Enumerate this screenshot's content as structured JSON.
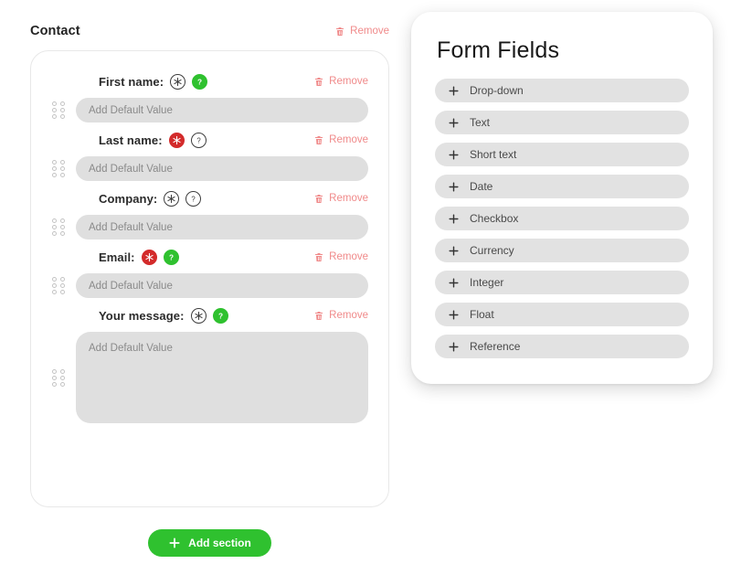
{
  "section": {
    "title": "Contact",
    "remove_label": "Remove",
    "remove_icon": "trash-icon"
  },
  "fields": [
    {
      "label": "First name:",
      "required_badge": {
        "icon": "asterisk-icon",
        "state": "off"
      },
      "help_badge": {
        "icon": "question-icon",
        "state": "on"
      },
      "remove_label": "Remove",
      "placeholder": "Add Default Value",
      "type": "input",
      "drag_handle": "drag-handle-icon"
    },
    {
      "label": "Last name:",
      "required_badge": {
        "icon": "asterisk-icon",
        "state": "on"
      },
      "help_badge": {
        "icon": "question-icon",
        "state": "off"
      },
      "remove_label": "Remove",
      "placeholder": "Add Default Value",
      "type": "input",
      "drag_handle": "drag-handle-icon"
    },
    {
      "label": "Company:",
      "required_badge": {
        "icon": "asterisk-icon",
        "state": "off"
      },
      "help_badge": {
        "icon": "question-icon",
        "state": "off"
      },
      "remove_label": "Remove",
      "placeholder": "Add Default Value",
      "type": "input",
      "drag_handle": "drag-handle-icon"
    },
    {
      "label": "Email:",
      "required_badge": {
        "icon": "asterisk-icon",
        "state": "on"
      },
      "help_badge": {
        "icon": "question-icon",
        "state": "on"
      },
      "remove_label": "Remove",
      "placeholder": "Add Default Value",
      "type": "input",
      "drag_handle": "drag-handle-icon"
    },
    {
      "label": "Your message:",
      "required_badge": {
        "icon": "asterisk-icon",
        "state": "off"
      },
      "help_badge": {
        "icon": "question-icon",
        "state": "on"
      },
      "remove_label": "Remove",
      "placeholder": "Add Default Value",
      "type": "textarea",
      "drag_handle": "drag-handle-icon"
    }
  ],
  "add_section": {
    "label": "Add section",
    "icon": "plus-icon"
  },
  "palette": {
    "title": "Form Fields",
    "items": [
      {
        "label": "Drop-down",
        "icon": "plus-icon"
      },
      {
        "label": "Text",
        "icon": "plus-icon"
      },
      {
        "label": "Short text",
        "icon": "plus-icon"
      },
      {
        "label": "Date",
        "icon": "plus-icon"
      },
      {
        "label": "Checkbox",
        "icon": "plus-icon"
      },
      {
        "label": "Currency",
        "icon": "plus-icon"
      },
      {
        "label": "Integer",
        "icon": "plus-icon"
      },
      {
        "label": "Float",
        "icon": "plus-icon"
      },
      {
        "label": "Reference",
        "icon": "plus-icon"
      }
    ]
  },
  "colors": {
    "accent_green": "#2fc12f",
    "required_red": "#d32b2b",
    "remove_red": "#f08a8a",
    "field_gray": "#dfdfdf",
    "palette_item_gray": "#e2e2e2"
  }
}
